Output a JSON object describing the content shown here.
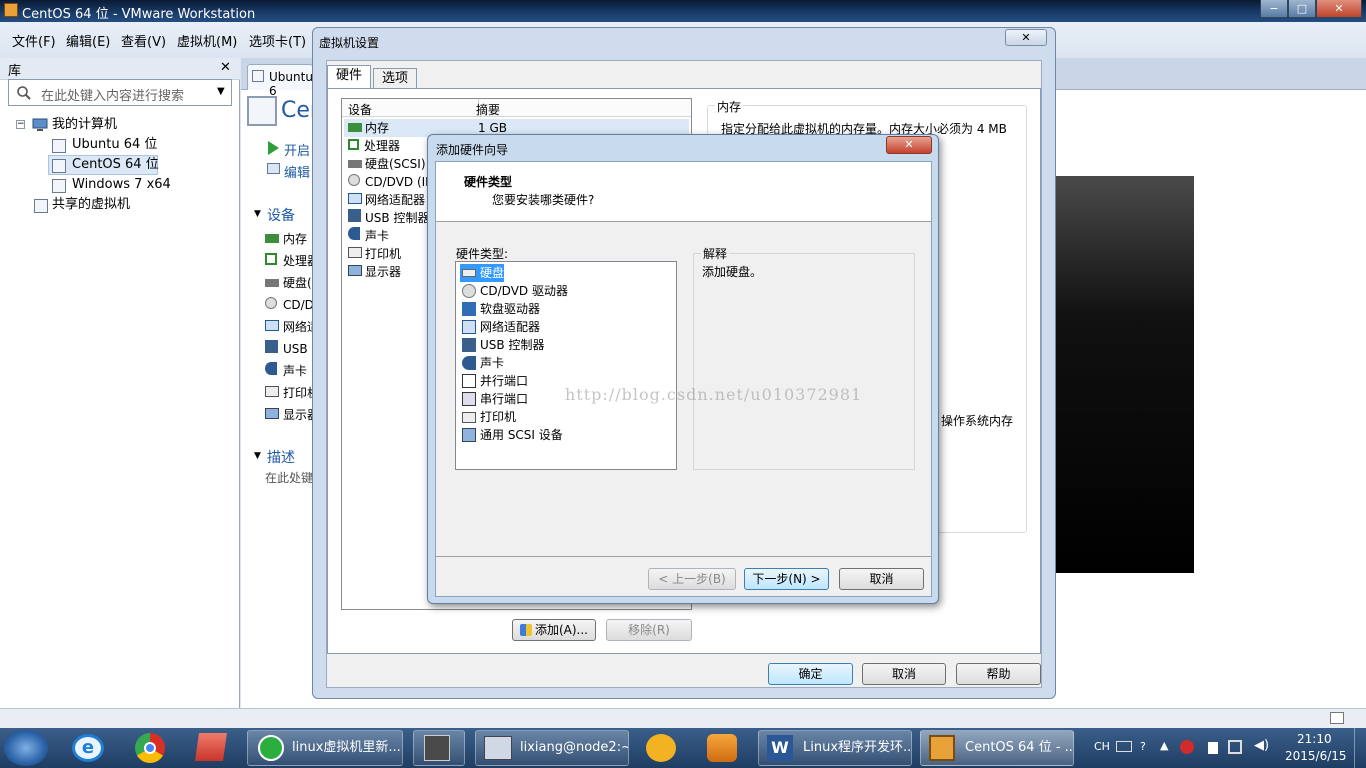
{
  "window": {
    "title": "CentOS 64 位 - VMware Workstation",
    "controls": [
      "−",
      "□",
      "✕"
    ]
  },
  "menubar": [
    "文件(F)",
    "编辑(E)",
    "查看(V)",
    "虚拟机(M)",
    "选项卡(T)"
  ],
  "library": {
    "title": "库",
    "close": "✕",
    "search_placeholder": "在此处键入内容进行搜索",
    "root": "我的计算机",
    "vms": [
      "Ubuntu 64 位",
      "CentOS 64 位",
      "Windows 7 x64"
    ],
    "shared": "共享的虚拟机"
  },
  "tab": {
    "label": "Ubuntu 6"
  },
  "vm": {
    "title_fragment": "Cen",
    "actions": [
      "开启",
      "编辑"
    ],
    "devices_header": "设备",
    "devices": [
      "内存",
      "处理器",
      "硬盘(",
      "CD/D",
      "网络适",
      "USB",
      "声卡",
      "打印机",
      "显示器"
    ],
    "describe_header": "描述",
    "describe_text": "在此处键"
  },
  "settings": {
    "title": "虚拟机设置",
    "close": "✕",
    "tabs": [
      "硬件",
      "选项"
    ],
    "columns": [
      "设备",
      "摘要"
    ],
    "devices": [
      {
        "name": "内存",
        "summary": "1 GB"
      },
      {
        "name": "处理器",
        "summary": ""
      },
      {
        "name": "硬盘(SCSI)",
        "summary": ""
      },
      {
        "name": "CD/DVD (ID",
        "summary": ""
      },
      {
        "name": "网络适配器",
        "summary": ""
      },
      {
        "name": "USB 控制器",
        "summary": ""
      },
      {
        "name": "声卡",
        "summary": ""
      },
      {
        "name": "打印机",
        "summary": ""
      },
      {
        "name": "显示器",
        "summary": ""
      }
    ],
    "memory": {
      "header": "内存",
      "desc": "指定分配给此虚拟机的内存量。内存大小必须为 4 MB",
      "fragment": "操作系统内存"
    },
    "add_button": "添加(A)...",
    "remove_button": "移除(R)",
    "ok": "确定",
    "cancel": "取消",
    "help": "帮助"
  },
  "wizard": {
    "title": "添加硬件向导",
    "close": "✕",
    "heading": "硬件类型",
    "subheading": "您要安装哪类硬件?",
    "list_label": "硬件类型:",
    "items": [
      "硬盘",
      "CD/DVD 驱动器",
      "软盘驱动器",
      "网络适配器",
      "USB 控制器",
      "声卡",
      "并行端口",
      "串行端口",
      "打印机",
      "通用 SCSI 设备"
    ],
    "selected_index": 0,
    "explain_label": "解释",
    "explain_text": "添加硬盘。",
    "back": "< 上一步(B)",
    "next": "下一步(N) >",
    "cancel": "取消"
  },
  "watermark": "http://blog.csdn.net/u010372981",
  "taskbar": {
    "tasks": [
      "linux虚拟机里新...",
      "",
      "lixiang@node2:~",
      "",
      "",
      "Linux程序开发环...",
      "CentOS 64 位 - ..."
    ],
    "tray": {
      "lang": "CH",
      "time": "21:10",
      "date": "2015/6/15"
    }
  },
  "colors": {
    "selection": "#3399ff",
    "title_bar": "#1a3d6b",
    "taskbar": "#2a4a73"
  }
}
